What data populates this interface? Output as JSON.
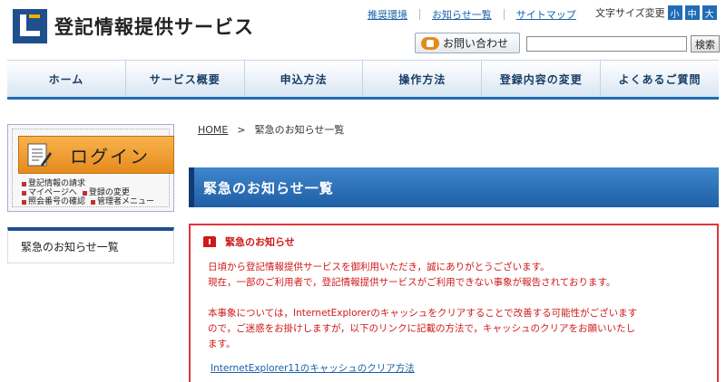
{
  "header": {
    "site_title": "登記情報提供サービス",
    "links": [
      "推奨環境",
      "お知らせ一覧",
      "サイトマップ"
    ],
    "font_size_label": "文字サイズ変更",
    "font_size_buttons": [
      "小",
      "中",
      "大"
    ],
    "contact_label": "お問い合わせ",
    "search_value": "",
    "search_button": "検索"
  },
  "nav": {
    "items": [
      "ホーム",
      "サービス概要",
      "申込方法",
      "操作方法",
      "登録内容の変更",
      "よくあるご質問"
    ]
  },
  "sidebar": {
    "login_label": "ログイン",
    "login_links": [
      "登記情報の請求",
      "マイページへ",
      "登録の変更",
      "照会番号の確認",
      "管理者メニュー"
    ],
    "menu_item": "緊急のお知らせ一覧"
  },
  "breadcrumb": {
    "home": "HOME",
    "separator": ">",
    "current": "緊急のお知らせ一覧"
  },
  "main": {
    "title": "緊急のお知らせ一覧",
    "notice": {
      "heading": "緊急のお知らせ",
      "lines": [
        "日頃から登記情報提供サービスを御利用いただき，誠にありがとうございます。",
        "現在，一部のご利用者で，登記情報提供サービスがご利用できない事象が報告されております。",
        "本事象については，InternetExplorerのキャッシュをクリアすることで改善する可能性がございます",
        "ので，ご迷惑をお掛けしますが，以下のリンクに記載の方法で，キャッシュのクリアをお願いいたし",
        "ます。"
      ],
      "link": "InternetExplorer11のキャッシュのクリア方法"
    }
  },
  "colors": {
    "brand_blue": "#1f6db5",
    "alert_red": "#d01818",
    "login_orange": "#e58b1d"
  }
}
